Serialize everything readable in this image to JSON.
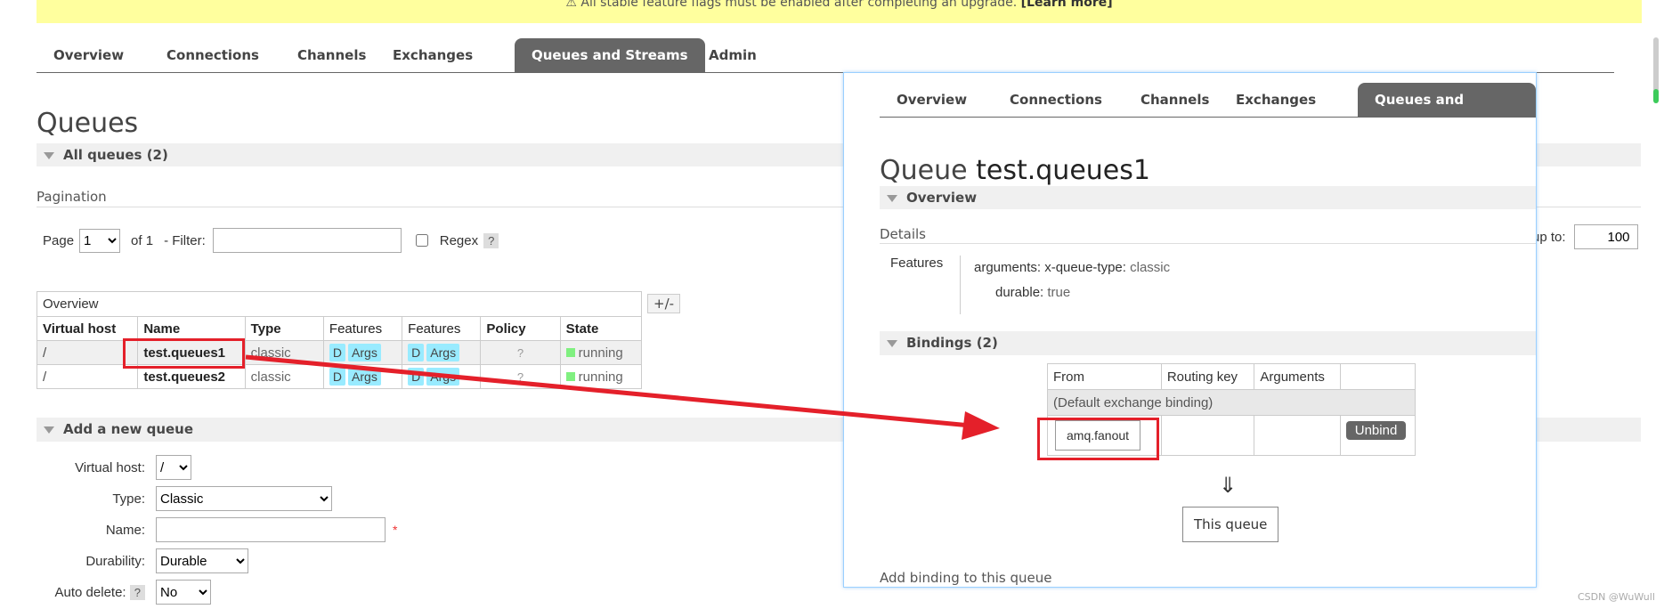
{
  "banner": {
    "text": "⚠ All stable feature flags must be enabled after completing an upgrade.",
    "link": "[Learn more]"
  },
  "nav": {
    "tabs": [
      "Overview",
      "Connections",
      "Channels",
      "Exchanges",
      "Queues and Streams",
      "Admin"
    ],
    "active": "Queues and Streams"
  },
  "page": {
    "title": "Queues",
    "all_queues": "All queues (2)",
    "pagination": "Pagination"
  },
  "pagination": {
    "page_label": "Page",
    "page_value": "1",
    "of_label": "of 1",
    "filter_label": "- Filter:",
    "filter_value": "",
    "regex_label": "Regex",
    "help": "?",
    "plusminus": "+/-",
    "display_up_to": "up to:",
    "display_value": "100"
  },
  "table": {
    "overview_label": "Overview",
    "headers": [
      "Virtual host",
      "Name",
      "Type",
      "Features",
      "Features",
      "Policy",
      "State"
    ],
    "rows": [
      {
        "vhost": "/",
        "name": "test.queues1",
        "type": "classic",
        "d": "D",
        "args": "Args",
        "policy": "?",
        "state": "running"
      },
      {
        "vhost": "/",
        "name": "test.queues2",
        "type": "classic",
        "d": "D",
        "args": "Args",
        "policy": "?",
        "state": "running"
      }
    ]
  },
  "add_queue": {
    "heading": "Add a new queue",
    "virtual_host_label": "Virtual host:",
    "virtual_host_value": "/",
    "type_label": "Type:",
    "type_value": "Classic",
    "name_label": "Name:",
    "name_value": "",
    "required": "*",
    "durability_label": "Durability:",
    "durability_value": "Durable",
    "auto_delete_label": "Auto delete:",
    "auto_delete_value": "No"
  },
  "panel": {
    "tabs": [
      "Overview",
      "Connections",
      "Channels",
      "Exchanges",
      "Queues and Streams"
    ],
    "title_prefix": "Queue",
    "title_name": "test.queues1",
    "overview_heading": "Overview",
    "details_label": "Details",
    "features_label": "Features",
    "arguments_key": "arguments:",
    "arguments_sub": "x-queue-type:",
    "arguments_val": "classic",
    "durable_key": "durable:",
    "durable_val": "true",
    "bindings_heading": "Bindings (2)",
    "bindings_headers": [
      "From",
      "Routing key",
      "Arguments",
      ""
    ],
    "default_binding": "(Default exchange binding)",
    "binding_from": "amq.fanout",
    "unbind": "Unbind",
    "arrow": "⇓",
    "this_queue": "This queue",
    "add_binding": "Add binding to this queue"
  },
  "watermark": "CSDN @WuWull",
  "colors": {
    "accent_red": "#e4202a",
    "running": "#80f080",
    "pill": "#99ebff",
    "tab_active": "#666666",
    "banner": "#ffff9e"
  }
}
